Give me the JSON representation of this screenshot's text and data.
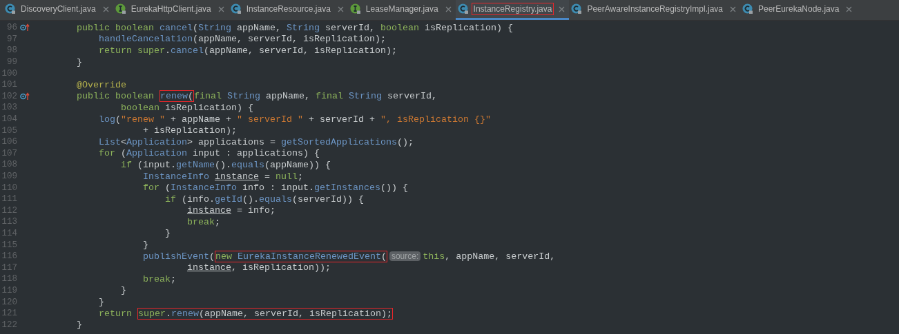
{
  "tabs": [
    {
      "label": "DiscoveryClient.java",
      "kind": "class",
      "selected": false,
      "boxed": false
    },
    {
      "label": "EurekaHttpClient.java",
      "kind": "interface",
      "selected": false,
      "boxed": false
    },
    {
      "label": "InstanceResource.java",
      "kind": "class",
      "selected": false,
      "boxed": false
    },
    {
      "label": "LeaseManager.java",
      "kind": "interface",
      "selected": false,
      "boxed": false
    },
    {
      "label": "InstanceRegistry.java",
      "kind": "class",
      "selected": true,
      "boxed": true
    },
    {
      "label": "PeerAwareInstanceRegistryImpl.java",
      "kind": "class",
      "selected": false,
      "boxed": false
    },
    {
      "label": "PeerEurekaNode.java",
      "kind": "class",
      "selected": false,
      "boxed": false
    }
  ],
  "lines": [
    {
      "number": "96",
      "overrides": true,
      "tokens": [
        {
          "text": "    public boolean ",
          "kind": "kw"
        },
        {
          "text": "cancel",
          "kind": "fn"
        },
        {
          "text": "(",
          "kind": "plain"
        },
        {
          "text": "String ",
          "kind": "type"
        },
        {
          "text": "appName, ",
          "kind": "plain"
        },
        {
          "text": "String ",
          "kind": "type"
        },
        {
          "text": "serverId, ",
          "kind": "plain"
        },
        {
          "text": "boolean ",
          "kind": "kw"
        },
        {
          "text": "isReplication) {",
          "kind": "plain"
        }
      ]
    },
    {
      "number": "97",
      "tokens": [
        {
          "text": "        handleCancelation",
          "kind": "fn"
        },
        {
          "text": "(appName, serverId, isReplication);",
          "kind": "plain"
        }
      ]
    },
    {
      "number": "98",
      "tokens": [
        {
          "text": "        return super",
          "kind": "kw"
        },
        {
          "text": ".",
          "kind": "plain"
        },
        {
          "text": "cancel",
          "kind": "fn"
        },
        {
          "text": "(appName, serverId, isReplication);",
          "kind": "plain"
        }
      ]
    },
    {
      "number": "99",
      "tokens": [
        {
          "text": "    }",
          "kind": "plain"
        }
      ]
    },
    {
      "number": "100"
    },
    {
      "number": "101",
      "tokens": [
        {
          "text": "    @Override",
          "kind": "ann"
        }
      ]
    },
    {
      "number": "102",
      "overrides": true,
      "tokens": [
        {
          "text": "    public boolean ",
          "kind": "kw"
        },
        {
          "kind": "box",
          "tokens": [
            {
              "text": "renew",
              "kind": "fn"
            },
            {
              "text": "(",
              "kind": "plain"
            }
          ]
        },
        {
          "text": "final ",
          "kind": "kw"
        },
        {
          "text": "String ",
          "kind": "type"
        },
        {
          "text": "appName, ",
          "kind": "plain"
        },
        {
          "text": "final ",
          "kind": "kw"
        },
        {
          "text": "String ",
          "kind": "type"
        },
        {
          "text": "serverId,",
          "kind": "plain"
        }
      ]
    },
    {
      "number": "103",
      "tokens": [
        {
          "text": "            boolean ",
          "kind": "kw"
        },
        {
          "text": "isReplication) {",
          "kind": "plain"
        }
      ]
    },
    {
      "number": "104",
      "tokens": [
        {
          "text": "        log",
          "kind": "fn"
        },
        {
          "text": "(",
          "kind": "plain"
        },
        {
          "text": "\"renew \"",
          "kind": "str"
        },
        {
          "text": " + appName + ",
          "kind": "plain"
        },
        {
          "text": "\" serverId \"",
          "kind": "str"
        },
        {
          "text": " + serverId + ",
          "kind": "plain"
        },
        {
          "text": "\", isReplication {}\"",
          "kind": "str"
        }
      ]
    },
    {
      "number": "105",
      "tokens": [
        {
          "text": "                + isReplication);",
          "kind": "plain"
        }
      ]
    },
    {
      "number": "106",
      "tokens": [
        {
          "text": "        List",
          "kind": "type"
        },
        {
          "text": "<",
          "kind": "plain"
        },
        {
          "text": "Application",
          "kind": "type"
        },
        {
          "text": "> applications = ",
          "kind": "plain"
        },
        {
          "text": "getSortedApplications",
          "kind": "fn"
        },
        {
          "text": "();",
          "kind": "plain"
        }
      ]
    },
    {
      "number": "107",
      "tokens": [
        {
          "text": "        for ",
          "kind": "kw"
        },
        {
          "text": "(",
          "kind": "plain"
        },
        {
          "text": "Application ",
          "kind": "type"
        },
        {
          "text": "input : applications) {",
          "kind": "plain"
        }
      ]
    },
    {
      "number": "108",
      "tokens": [
        {
          "text": "            if ",
          "kind": "kw"
        },
        {
          "text": "(input.",
          "kind": "plain"
        },
        {
          "text": "getName",
          "kind": "fn"
        },
        {
          "text": "().",
          "kind": "plain"
        },
        {
          "text": "equals",
          "kind": "fn"
        },
        {
          "text": "(appName)) {",
          "kind": "plain"
        }
      ]
    },
    {
      "number": "109",
      "tokens": [
        {
          "text": "                InstanceInfo ",
          "kind": "type"
        },
        {
          "text": "instance",
          "kind": "var"
        },
        {
          "text": " = ",
          "kind": "plain"
        },
        {
          "text": "null",
          "kind": "kw"
        },
        {
          "text": ";",
          "kind": "plain"
        }
      ]
    },
    {
      "number": "110",
      "tokens": [
        {
          "text": "                for ",
          "kind": "kw"
        },
        {
          "text": "(",
          "kind": "plain"
        },
        {
          "text": "InstanceInfo ",
          "kind": "type"
        },
        {
          "text": "info : input.",
          "kind": "plain"
        },
        {
          "text": "getInstances",
          "kind": "fn"
        },
        {
          "text": "()) {",
          "kind": "plain"
        }
      ]
    },
    {
      "number": "111",
      "tokens": [
        {
          "text": "                    if ",
          "kind": "kw"
        },
        {
          "text": "(info.",
          "kind": "plain"
        },
        {
          "text": "getId",
          "kind": "fn"
        },
        {
          "text": "().",
          "kind": "plain"
        },
        {
          "text": "equals",
          "kind": "fn"
        },
        {
          "text": "(serverId)) {",
          "kind": "plain"
        }
      ]
    },
    {
      "number": "112",
      "tokens": [
        {
          "text": "                        instance",
          "kind": "var"
        },
        {
          "text": " = info;",
          "kind": "plain"
        }
      ]
    },
    {
      "number": "113",
      "tokens": [
        {
          "text": "                        break",
          "kind": "kw"
        },
        {
          "text": ";",
          "kind": "plain"
        }
      ]
    },
    {
      "number": "114",
      "tokens": [
        {
          "text": "                    }",
          "kind": "plain"
        }
      ]
    },
    {
      "number": "115",
      "tokens": [
        {
          "text": "                }",
          "kind": "plain"
        }
      ]
    },
    {
      "number": "116",
      "tokens": [
        {
          "text": "                publishEvent",
          "kind": "fn"
        },
        {
          "text": "(",
          "kind": "plain"
        },
        {
          "kind": "box",
          "tokens": [
            {
              "text": "new ",
              "kind": "kw"
            },
            {
              "text": "EurekaInstanceRenewedEvent",
              "kind": "type"
            },
            {
              "text": "(",
              "kind": "plain"
            }
          ]
        },
        {
          "text": "source:",
          "kind": "hint"
        },
        {
          "text": "this",
          "kind": "kw"
        },
        {
          "text": ", appName, serverId,",
          "kind": "plain"
        }
      ]
    },
    {
      "number": "117",
      "tokens": [
        {
          "text": "                        instance",
          "kind": "var"
        },
        {
          "text": ", isReplication));",
          "kind": "plain"
        }
      ]
    },
    {
      "number": "118",
      "tokens": [
        {
          "text": "                break",
          "kind": "kw"
        },
        {
          "text": ";",
          "kind": "plain"
        }
      ]
    },
    {
      "number": "119",
      "tokens": [
        {
          "text": "            }",
          "kind": "plain"
        }
      ]
    },
    {
      "number": "120",
      "tokens": [
        {
          "text": "        }",
          "kind": "plain"
        }
      ]
    },
    {
      "number": "121",
      "tokens": [
        {
          "text": "        return ",
          "kind": "kw"
        },
        {
          "kind": "box",
          "tokens": [
            {
              "text": "super",
              "kind": "kw"
            },
            {
              "text": ".",
              "kind": "plain"
            },
            {
              "text": "renew",
              "kind": "fn"
            },
            {
              "text": "(appName, serverId, isReplication);",
              "kind": "plain"
            }
          ]
        }
      ]
    },
    {
      "number": "122",
      "tokens": [
        {
          "text": "    }",
          "kind": "plain"
        }
      ]
    }
  ]
}
